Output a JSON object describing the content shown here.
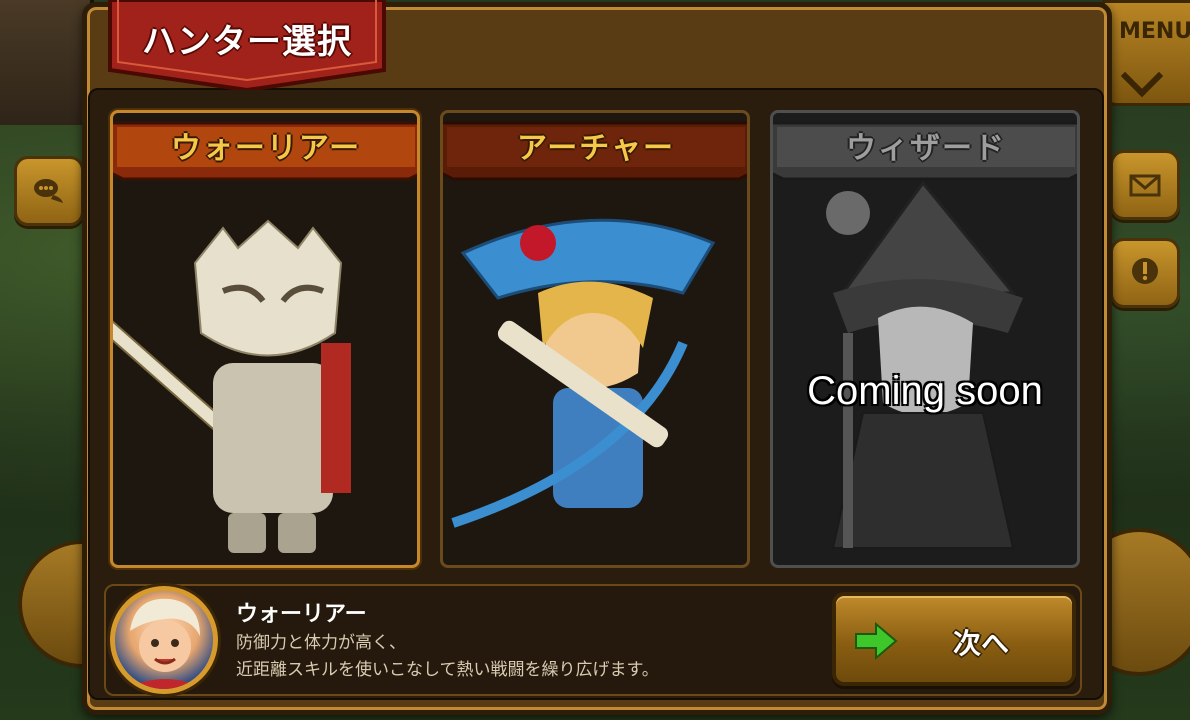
{
  "header": {
    "title": "ハンター選択",
    "menu_label": "MENU"
  },
  "hunters": [
    {
      "name": "ウォーリアー",
      "state": "selected"
    },
    {
      "name": "アーチャー",
      "state": "available"
    },
    {
      "name": "ウィザード",
      "state": "locked",
      "overlay": "Coming soon"
    }
  ],
  "info": {
    "name": "ウォーリアー",
    "desc_line1": "防御力と体力が高く、",
    "desc_line2": "近距離スキルを使いこなして熱い戦闘を繰り広げます。"
  },
  "next_button": {
    "label": "次へ"
  },
  "icons": {
    "chat": "chat-bubbles-icon",
    "mail": "envelope-icon",
    "notice": "exclamation-bubble-icon",
    "next": "green-arrow-icon"
  },
  "colors": {
    "accent_gold": "#f6c84a",
    "banner_red": "#a0221a",
    "locked_gray": "#9e9e9e",
    "arrow_green": "#3ec72a"
  }
}
